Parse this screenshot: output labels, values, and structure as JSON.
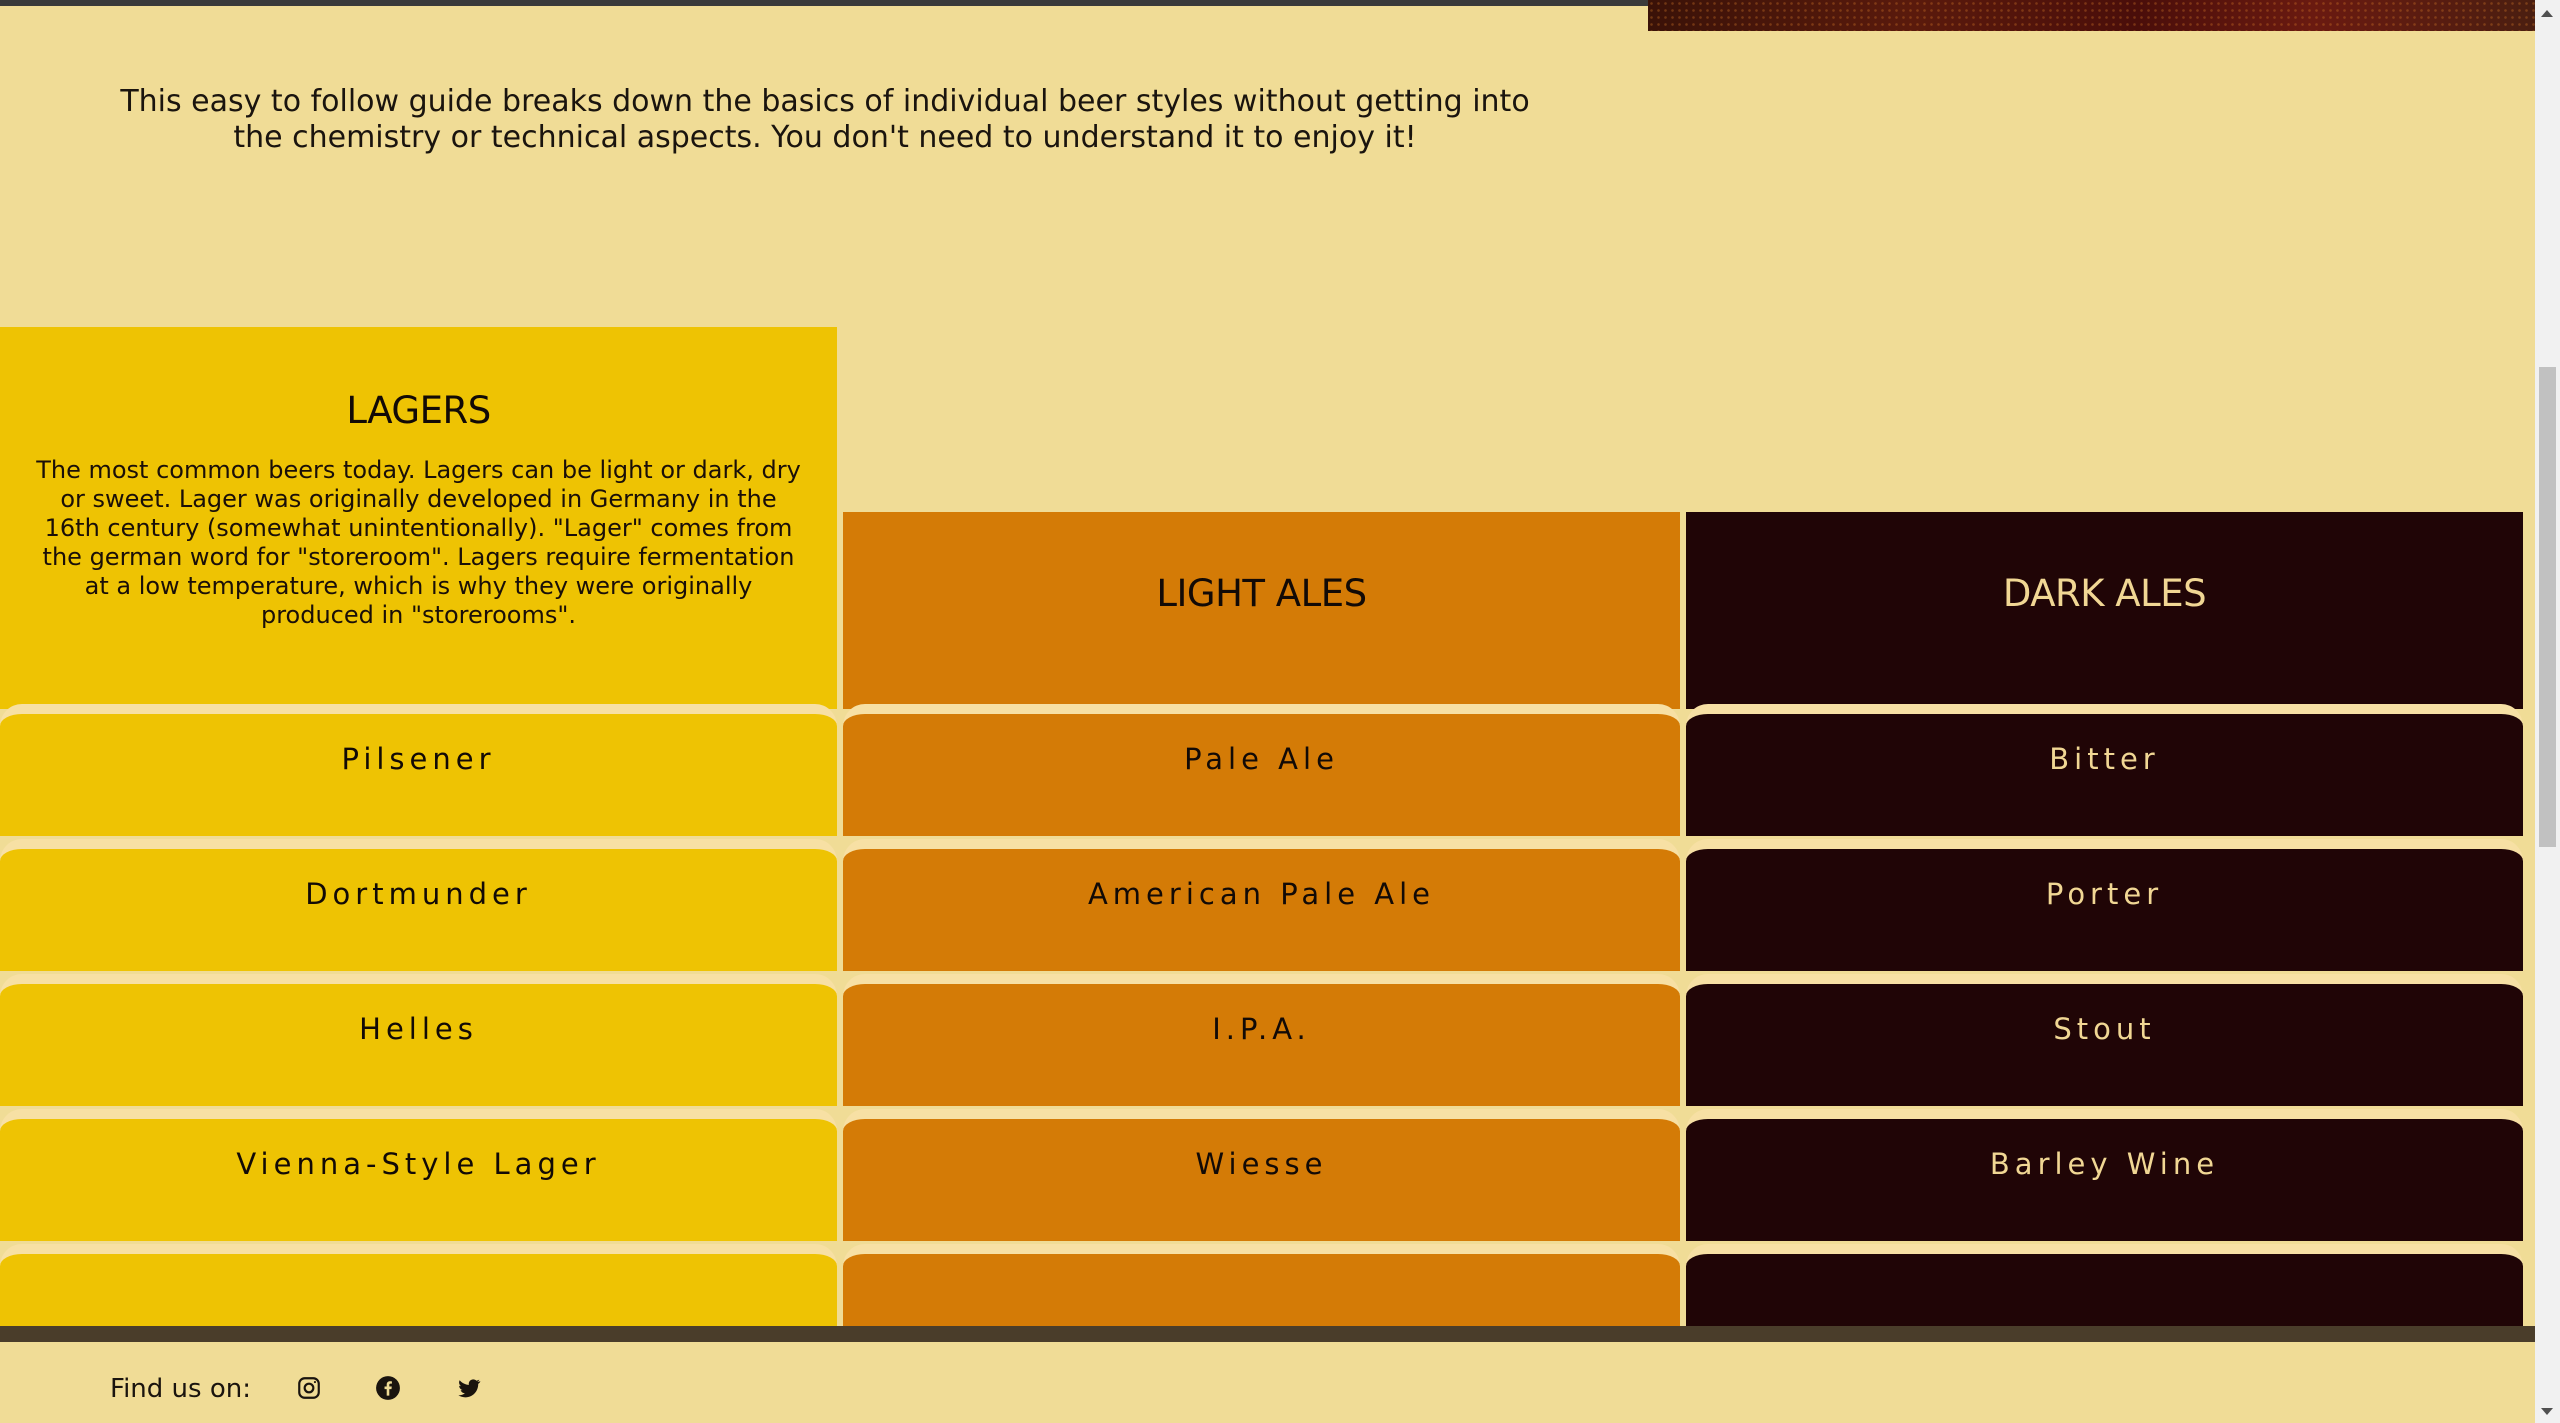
{
  "intro": "This easy to follow guide breaks down the basics of individual beer styles without getting into the chemistry or technical aspects. You don't need to understand it to enjoy it!",
  "columns": {
    "lagers": {
      "title": "LAGERS",
      "description": "The most common beers today. Lagers can be light or dark, dry or sweet. Lager was originally developed in Germany in the 16th century (somewhat unintentionally). \"Lager\" comes from the german word for \"storeroom\". Lagers require fermentation at a low temperature, which is why they were originally produced in \"storerooms\".",
      "items": [
        "Pilsener",
        "Dortmunder",
        "Helles",
        "Vienna-Style Lager",
        ""
      ]
    },
    "light_ales": {
      "title": "LIGHT ALES",
      "items": [
        "Pale Ale",
        "American Pale Ale",
        "I.P.A.",
        "Wiesse",
        ""
      ]
    },
    "dark_ales": {
      "title": "DARK ALES",
      "items": [
        "Bitter",
        "Porter",
        "Stout",
        "Barley Wine",
        ""
      ]
    }
  },
  "footer": {
    "find_us_label": "Find us on:",
    "social_icons": [
      "instagram-icon",
      "facebook-icon",
      "twitter-icon"
    ]
  },
  "colors": {
    "page_bg": "#f0dc96",
    "lagers": "#eec303",
    "light_ales": "#d47b06",
    "dark_ales": "#200506",
    "dark_text": "#f1d794"
  }
}
